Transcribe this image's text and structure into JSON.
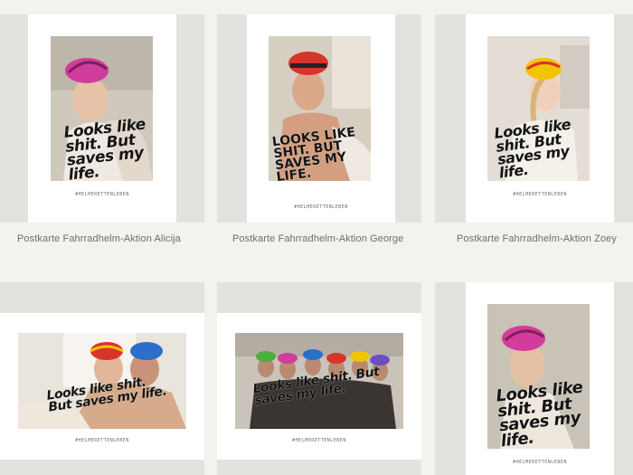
{
  "products": [
    {
      "caption": "Postkarte Fahrradhelm-Aktion Alicija",
      "slogan": "Looks like shit. But saves my life.",
      "hashtag": "#HELMERETTENLEBEN"
    },
    {
      "caption": "Postkarte Fahrradhelm-Aktion George",
      "slogan": "Looks like shit. But saves my life.",
      "hashtag": "#HELMERETTENLEBEN"
    },
    {
      "caption": "Postkarte Fahrradhelm-Aktion Zoey",
      "slogan": "Looks like shit. But saves my life.",
      "hashtag": "#HELMERETTENLEBEN"
    },
    {
      "caption": "",
      "slogan": "Looks like shit. But saves my life.",
      "hashtag": "#HELMERETTENLEBEN"
    },
    {
      "caption": "",
      "slogan": "Looks like shit. But saves my life.",
      "hashtag": "#HELMERETTENLEBEN"
    },
    {
      "caption": "",
      "slogan": "Looks like shit. But saves my life.",
      "hashtag": "#HELMERETTENLEBEN"
    }
  ],
  "colors": {
    "page_bg": "#f4f2ef",
    "tile_bg": "#e4e2de",
    "card_bg": "#ffffff",
    "helmet_pink": "#d23c9a",
    "helmet_red": "#d8342a",
    "helmet_yellow": "#f2c400",
    "helmet_blue": "#2a6fc9",
    "helmet_green": "#4cae3c"
  }
}
